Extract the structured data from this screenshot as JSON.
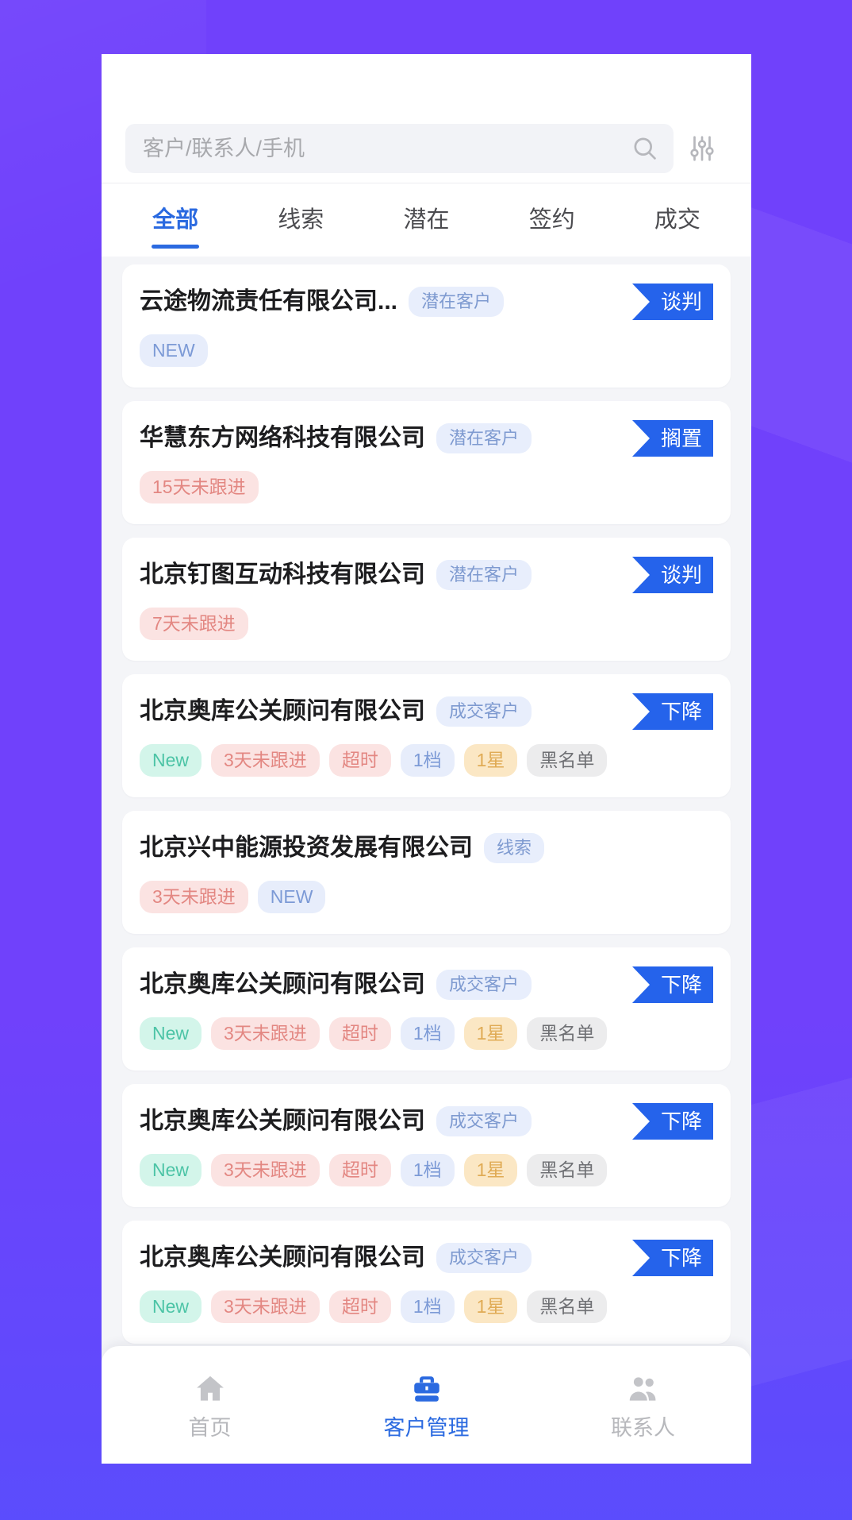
{
  "theme": {
    "backdrop_purple": "#7041fb",
    "accent_blue": "#2b6ae0",
    "flag_blue": "#2563eb",
    "card_bg": "#ffffff",
    "list_bg": "#f4f5f8"
  },
  "search": {
    "placeholder": "客户/联系人/手机",
    "value": "",
    "search_icon": "search-icon",
    "filter_icon": "filter-sliders-icon"
  },
  "tabs": [
    {
      "label": "全部",
      "active": true
    },
    {
      "label": "线索",
      "active": false
    },
    {
      "label": "潜在",
      "active": false
    },
    {
      "label": "签约",
      "active": false
    },
    {
      "label": "成交",
      "active": false
    }
  ],
  "cards": [
    {
      "title": "云途物流责任有限公司...",
      "type_badge": "潜在客户",
      "flag": "谈判",
      "tags": [
        {
          "label": "NEW",
          "color": "blue"
        }
      ]
    },
    {
      "title": "华慧东方网络科技有限公司",
      "type_badge": "潜在客户",
      "flag": "搁置",
      "tags": [
        {
          "label": "15天未跟进",
          "color": "red"
        }
      ]
    },
    {
      "title": "北京钉图互动科技有限公司",
      "type_badge": "潜在客户",
      "flag": "谈判",
      "tags": [
        {
          "label": "7天未跟进",
          "color": "red"
        }
      ]
    },
    {
      "title": "北京奥库公关顾问有限公司",
      "type_badge": "成交客户",
      "flag": "下降",
      "tags": [
        {
          "label": "New",
          "color": "teal"
        },
        {
          "label": "3天未跟进",
          "color": "red"
        },
        {
          "label": "超时",
          "color": "red"
        },
        {
          "label": "1档",
          "color": "blue"
        },
        {
          "label": "1星",
          "color": "orange"
        },
        {
          "label": "黑名单",
          "color": "gray"
        }
      ]
    },
    {
      "title": "北京兴中能源投资发展有限公司",
      "type_badge": "线索",
      "flag": "",
      "tags": [
        {
          "label": "3天未跟进",
          "color": "red"
        },
        {
          "label": "NEW",
          "color": "blue"
        }
      ]
    },
    {
      "title": "北京奥库公关顾问有限公司",
      "type_badge": "成交客户",
      "flag": "下降",
      "tags": [
        {
          "label": "New",
          "color": "teal"
        },
        {
          "label": "3天未跟进",
          "color": "red"
        },
        {
          "label": "超时",
          "color": "red"
        },
        {
          "label": "1档",
          "color": "blue"
        },
        {
          "label": "1星",
          "color": "orange"
        },
        {
          "label": "黑名单",
          "color": "gray"
        }
      ]
    },
    {
      "title": "北京奥库公关顾问有限公司",
      "type_badge": "成交客户",
      "flag": "下降",
      "tags": [
        {
          "label": "New",
          "color": "teal"
        },
        {
          "label": "3天未跟进",
          "color": "red"
        },
        {
          "label": "超时",
          "color": "red"
        },
        {
          "label": "1档",
          "color": "blue"
        },
        {
          "label": "1星",
          "color": "orange"
        },
        {
          "label": "黑名单",
          "color": "gray"
        }
      ]
    },
    {
      "title": "北京奥库公关顾问有限公司",
      "type_badge": "成交客户",
      "flag": "下降",
      "tags": [
        {
          "label": "New",
          "color": "teal"
        },
        {
          "label": "3天未跟进",
          "color": "red"
        },
        {
          "label": "超时",
          "color": "red"
        },
        {
          "label": "1档",
          "color": "blue"
        },
        {
          "label": "1星",
          "color": "orange"
        },
        {
          "label": "黑名单",
          "color": "gray"
        }
      ]
    }
  ],
  "bottom_nav": [
    {
      "label": "首页",
      "icon": "home-icon",
      "active": false
    },
    {
      "label": "客户管理",
      "icon": "briefcase-icon",
      "active": true
    },
    {
      "label": "联系人",
      "icon": "people-icon",
      "active": false
    }
  ]
}
